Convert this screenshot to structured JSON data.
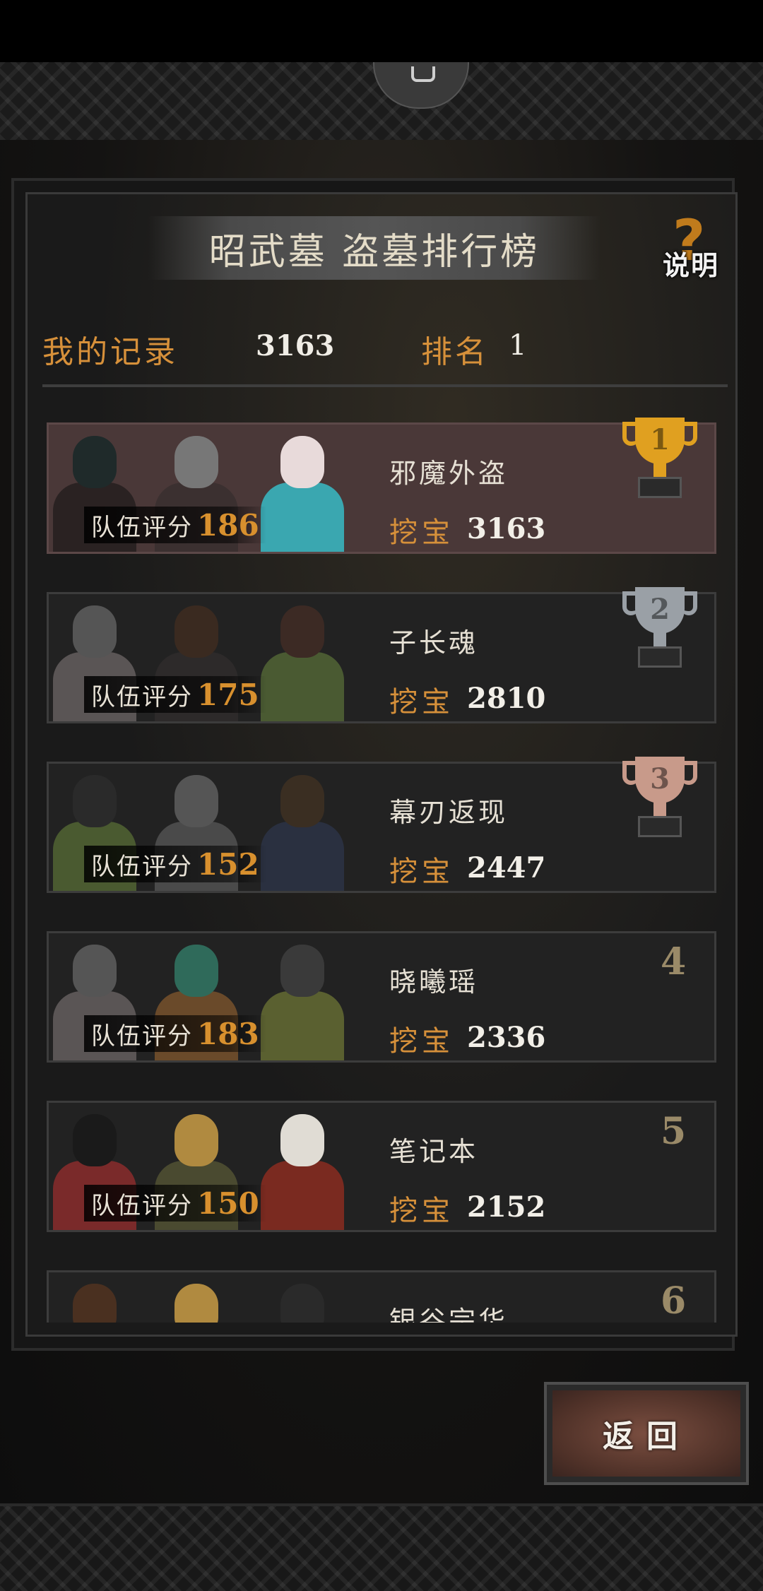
{
  "header": {
    "title": "昭武墓 盗墓排行榜",
    "help_label": "说明"
  },
  "my_record": {
    "label": "我的记录",
    "score": "3163",
    "rank_label": "排名",
    "rank_value": "1"
  },
  "leaderboard": [
    {
      "rank": "1",
      "name": "邪魔外盗",
      "team_label": "队伍评分",
      "team_score": "186",
      "dig_label": "挖宝",
      "dig_score": "3163",
      "trophy": "gold"
    },
    {
      "rank": "2",
      "name": "子长魂",
      "team_label": "队伍评分",
      "team_score": "175",
      "dig_label": "挖宝",
      "dig_score": "2810",
      "trophy": "silver"
    },
    {
      "rank": "3",
      "name": "幕刃返现",
      "team_label": "队伍评分",
      "team_score": "152",
      "dig_label": "挖宝",
      "dig_score": "2447",
      "trophy": "bronze"
    },
    {
      "rank": "4",
      "name": "晓曦瑶",
      "team_label": "队伍评分",
      "team_score": "183",
      "dig_label": "挖宝",
      "dig_score": "2336",
      "trophy": "none"
    },
    {
      "rank": "5",
      "name": "笔记本",
      "team_label": "队伍评分",
      "team_score": "150",
      "dig_label": "挖宝",
      "dig_score": "2152",
      "trophy": "none"
    },
    {
      "rank": "6",
      "name": "银谷宗华",
      "team_label": "",
      "team_score": "",
      "dig_label": "",
      "dig_score": "",
      "trophy": "none"
    }
  ],
  "back_label": "返回",
  "colors": {
    "accent_orange": "#d6903a",
    "gold": "#e0a020",
    "silver": "#9aa0a6",
    "bronze": "#c89a8a",
    "highlight_row": "#4a3838"
  },
  "icons": [
    "question-mark-icon",
    "gold-trophy-icon",
    "silver-trophy-icon",
    "bronze-trophy-icon"
  ]
}
